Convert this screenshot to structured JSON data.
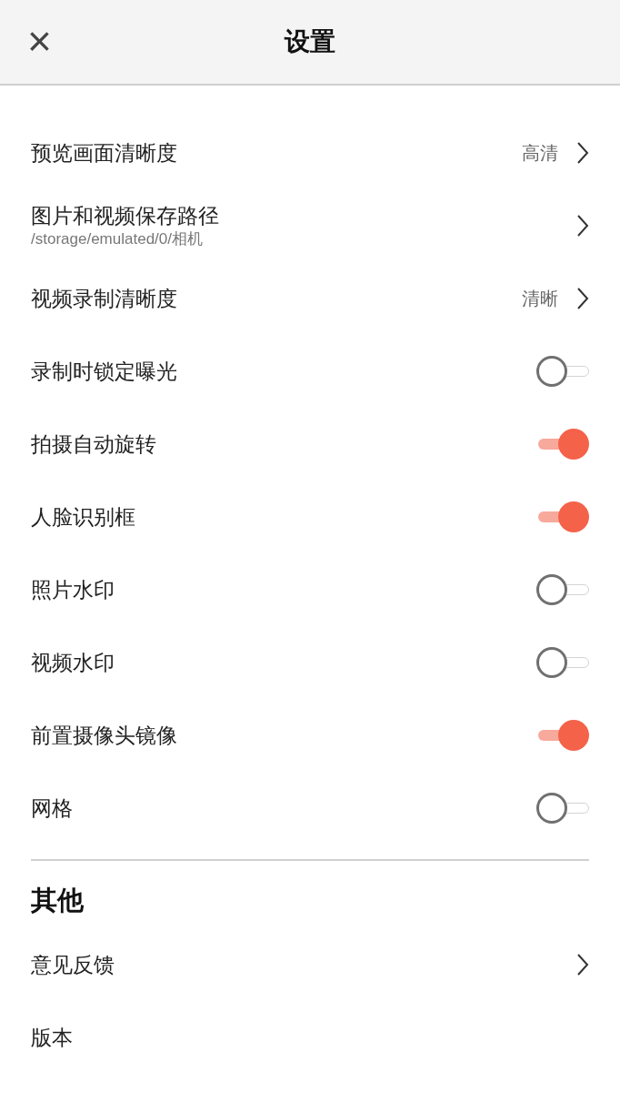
{
  "header": {
    "close": "×",
    "title": "设置"
  },
  "settings": [
    {
      "kind": "link",
      "label": "预览画面清晰度",
      "value": "高清"
    },
    {
      "kind": "link",
      "label": "图片和视频保存路径",
      "subtitle": "/storage/emulated/0/相机"
    },
    {
      "kind": "link",
      "label": "视频录制清晰度",
      "value": "清晰"
    },
    {
      "kind": "toggle",
      "label": "录制时锁定曝光",
      "on": false
    },
    {
      "kind": "toggle",
      "label": "拍摄自动旋转",
      "on": true
    },
    {
      "kind": "toggle",
      "label": "人脸识别框",
      "on": true
    },
    {
      "kind": "toggle",
      "label": "照片水印",
      "on": false
    },
    {
      "kind": "toggle",
      "label": "视频水印",
      "on": false
    },
    {
      "kind": "toggle",
      "label": "前置摄像头镜像",
      "on": true
    },
    {
      "kind": "toggle",
      "label": "网格",
      "on": false
    }
  ],
  "other": {
    "title": "其他",
    "items": [
      {
        "kind": "link",
        "label": "意见反馈"
      },
      {
        "kind": "plain",
        "label": "版本"
      }
    ]
  }
}
